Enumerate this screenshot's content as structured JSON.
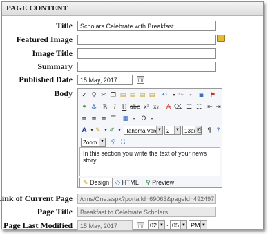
{
  "section_title": "PAGE CONTENT",
  "fields": {
    "title_label": "Title",
    "title_value": "Scholars Celebrate with Breakfast",
    "featured_image_label": "Featured Image",
    "image_title_label": "Image Title",
    "summary_label": "Summary",
    "published_date_label": "Published Date",
    "published_date_value": "15 May, 2017",
    "body_label": "Body",
    "link_label": "Link of Current Page",
    "link_value": "/cms/One.aspx?portalId=69063&pageId=492497",
    "page_title_label": "Page Title",
    "page_title_value": "Breakfast to Celebrate Scholars",
    "last_modified_label": "Page Last Modified",
    "last_modified_date": "15 May, 2017",
    "last_modified_hour": "02",
    "last_modified_minute": "05",
    "last_modified_ampm": "PM"
  },
  "editor": {
    "font_value": "Tahoma,Verd...",
    "size_value": "2",
    "px_value": "13px",
    "zoom_value": "Zoom",
    "content_text": "In this section you write the text of your news story.",
    "tab_design": "Design",
    "tab_html": "HTML",
    "tab_preview": "Preview",
    "format_bold": "B",
    "format_italic": "I",
    "format_underline": "U",
    "format_strike": "abc",
    "format_sub": "x₂",
    "format_sup": "x²",
    "omega": "Ω"
  },
  "icons": [
    "cut-icon",
    "copy-icon",
    "paste-icon",
    "undo-icon",
    "redo-icon",
    "image-icon",
    "link-icon",
    "bold-icon",
    "italic-icon",
    "underline-icon",
    "align-left-icon",
    "align-center-icon",
    "align-right-icon",
    "justify-icon",
    "table-icon",
    "font-color-icon",
    "highlight-icon",
    "print-icon",
    "help-icon",
    "calendar-icon",
    "folder-icon"
  ],
  "colors": {
    "accent": "#1f5fbf",
    "folder": "#e3b935",
    "header_bg": "#e5e5e5"
  }
}
